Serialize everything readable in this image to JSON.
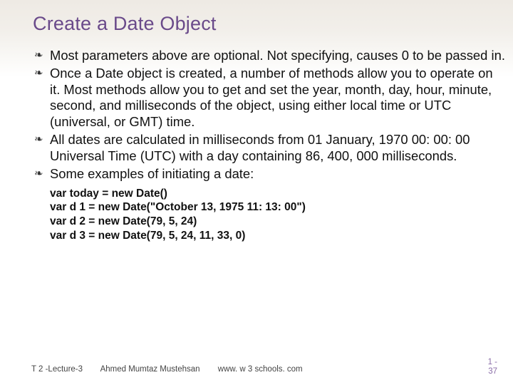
{
  "title": "Create a Date Object",
  "bullets": [
    "Most parameters above are optional. Not specifying, causes 0 to be passed in.",
    "Once a Date object is created, a number of methods allow you to operate on it. Most methods allow you to get and set the year, month, day, hour, minute, second, and milliseconds of the object, using either local time or UTC (universal, or GMT) time.",
    "All dates are calculated in milliseconds from 01 January, 1970 00: 00: 00 Universal Time (UTC) with a day containing 86, 400, 000 milliseconds.",
    "Some examples of initiating a date:"
  ],
  "code": [
    "var today = new Date()",
    "var d 1 = new Date(\"October 13, 1975 11: 13: 00\")",
    "var d 2 = new Date(79, 5, 24)",
    "var d 3 = new Date(79, 5, 24, 11, 33, 0)"
  ],
  "footer": {
    "left": "T 2 -Lecture-3",
    "center": "Ahmed Mumtaz Mustehsan",
    "right": "www. w 3 schools. com"
  },
  "page": {
    "top": "1 -",
    "bottom": "37"
  },
  "bullet_glyph": "❧"
}
